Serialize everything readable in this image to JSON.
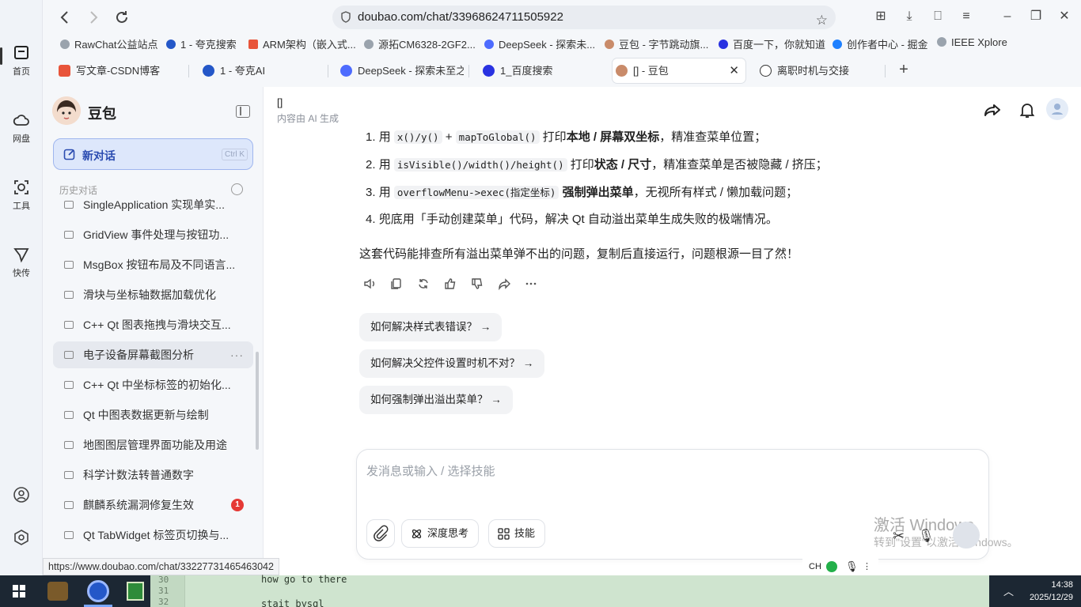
{
  "rail": {
    "items": [
      {
        "label": "首页",
        "icon": "home-icon"
      },
      {
        "label": "网盘",
        "icon": "cloud-icon"
      },
      {
        "label": "工具",
        "icon": "tools-icon"
      },
      {
        "label": "快传",
        "icon": "send-icon"
      }
    ],
    "bottom_icons": [
      "user-circle-icon",
      "settings-hex-icon"
    ]
  },
  "browser": {
    "url": "doubao.com/chat/33968624711505922",
    "bookmarks": [
      "RawChat公益站点",
      "1 - 夸克搜索",
      "ARM架构（嵌入式...",
      "源拓CM6328-2GF2...",
      "DeepSeek - 探索未...",
      "豆包 - 字节跳动旗...",
      "百度一下，你就知道",
      "创作者中心 - 掘金",
      "IEEE Xplore"
    ],
    "tabs": [
      {
        "label": "写文章-CSDN博客"
      },
      {
        "label": "1 - 夸克AI"
      },
      {
        "label": "DeepSeek - 探索未至之"
      },
      {
        "label": "1_百度搜索"
      },
      {
        "label": "[] - 豆包"
      },
      {
        "label": "离职时机与交接"
      }
    ],
    "new_tab": "+",
    "status_url": "https://www.doubao.com/chat/33227731465463042"
  },
  "sidebar": {
    "brand": "豆包",
    "new_chat": "新对话",
    "new_chat_shortcut": "Ctrl K",
    "history_header": "历史对话",
    "history": [
      {
        "title": "SingleApplication 实现单实..."
      },
      {
        "title": "GridView 事件处理与按钮功..."
      },
      {
        "title": "MsgBox 按钮布局及不同语言..."
      },
      {
        "title": "滑块与坐标轴数据加载优化"
      },
      {
        "title": "C++ Qt 图表拖拽与滑块交互..."
      },
      {
        "title": "电子设备屏幕截图分析",
        "more": "···"
      },
      {
        "title": "C++ Qt 中坐标标签的初始化..."
      },
      {
        "title": "Qt 中图表数据更新与绘制"
      },
      {
        "title": "地图图层管理界面功能及用途"
      },
      {
        "title": "科学计数法转普通数字"
      },
      {
        "title": "麒麟系统漏洞修复生效",
        "badge": "1"
      },
      {
        "title": "Qt TabWidget 标签页切换与..."
      }
    ]
  },
  "conversation": {
    "title": "[]",
    "subtitle": "内容由 AI 生成",
    "list": [
      {
        "num": "1.",
        "pre": "用",
        "code": "x()/y()",
        "mid": " + ",
        "code2": "mapToGlobal()",
        "mid2": " 打印",
        "bold": "本地 / 屏幕双坐标",
        "post": "，精准查菜单位置；"
      },
      {
        "num": "2.",
        "pre": "用",
        "code": "isVisible()/width()/height()",
        "mid": " 打印",
        "bold": "状态 / 尺寸",
        "post": "，精准查菜单是否被隐藏 / 挤压；"
      },
      {
        "num": "3.",
        "pre": "用",
        "code": "overflowMenu->exec(指定坐标)",
        "bold": "强制弹出菜单",
        "post": "，无视所有样式 / 懒加载问题；"
      },
      {
        "num": "4.",
        "text": "兜底用「手动创建菜单」代码，解决 Qt 自动溢出菜单生成失败的极端情况。"
      }
    ],
    "summary": "这套代码能排查所有溢出菜单弹不出的问题，复制后直接运行，问题根源一目了然！",
    "actions": [
      "speaker-icon",
      "copy-icon",
      "regenerate-icon",
      "thumbs-up-icon",
      "thumbs-down-icon",
      "share-icon",
      "more-icon"
    ],
    "suggestions": [
      "如何解决样式表错误？ →",
      "如何解决父控件设置时机不对？ →",
      "如何强制弹出溢出菜单？ →"
    ]
  },
  "composer": {
    "placeholder": "发消息或输入 / 选择技能",
    "deep_think": "深度思考",
    "skills": "技能"
  },
  "watermark": {
    "line1": "激活 Windows",
    "line2": "转到\"设置\"以激活 Windows。"
  },
  "ime": {
    "label": "CH"
  },
  "editor": {
    "lines": [
      {
        "num": "30",
        "code": "how go to there"
      },
      {
        "num": "31",
        "code": ""
      },
      {
        "num": "32",
        "code": "stait bysql"
      }
    ]
  },
  "taskbar": {
    "time": "14:38",
    "date": "2025/12/29"
  },
  "colors": {
    "accent": "#2a4bb0",
    "new_chat_bg": "#dde7fb",
    "badge": "#e53935",
    "taskbar": "#1c2733",
    "editor_bg": "#cfe4cf"
  }
}
